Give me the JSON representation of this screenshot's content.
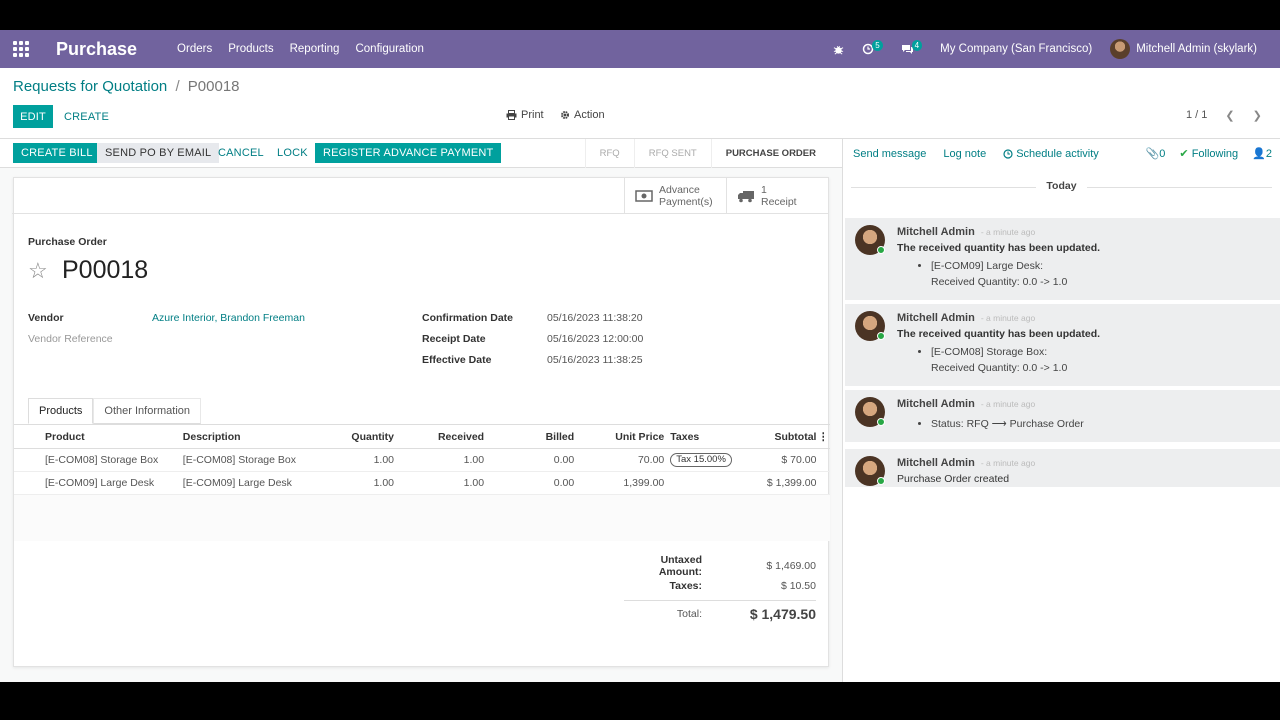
{
  "navbar": {
    "app_name": "Purchase",
    "menu": [
      "Orders",
      "Products",
      "Reporting",
      "Configuration"
    ],
    "activity_badge": "5",
    "messages_badge": "4",
    "company": "My Company (San Francisco)",
    "user": "Mitchell Admin (skylark)"
  },
  "breadcrumb": {
    "parent": "Requests for Quotation",
    "separator": "/",
    "current": "P00018"
  },
  "control": {
    "edit": "EDIT",
    "create": "CREATE",
    "print": "Print",
    "action": "Action",
    "pager": "1 / 1"
  },
  "statusbar": {
    "buttons": [
      "CREATE BILL",
      "SEND PO BY EMAIL",
      "CANCEL",
      "LOCK",
      "REGISTER ADVANCE PAYMENT"
    ],
    "stages": [
      "RFQ",
      "RFQ SENT",
      "PURCHASE ORDER"
    ],
    "active_stage": "PURCHASE ORDER"
  },
  "smart_buttons": {
    "advance": {
      "line1": "Advance",
      "line2": "Payment(s)"
    },
    "receipt": {
      "line1": "1",
      "line2": "Receipt"
    }
  },
  "form": {
    "heading": "Purchase Order",
    "name": "P00018",
    "vendor_label": "Vendor",
    "vendor_value": "Azure Interior, Brandon Freeman",
    "vendor_ref_label": "Vendor Reference",
    "confirmation_label": "Confirmation Date",
    "confirmation_value": "05/16/2023 11:38:20",
    "receipt_label": "Receipt Date",
    "receipt_value": "05/16/2023 12:00:00",
    "effective_label": "Effective Date",
    "effective_value": "05/16/2023 11:38:25"
  },
  "tabs": [
    "Products",
    "Other Information"
  ],
  "lines": {
    "headers": [
      "Product",
      "Description",
      "Quantity",
      "Received",
      "Billed",
      "Unit Price",
      "Taxes",
      "Subtotal"
    ],
    "rows": [
      {
        "product": "[E-COM08] Storage Box",
        "description": "[E-COM08] Storage Box",
        "quantity": "1.00",
        "received": "1.00",
        "billed": "0.00",
        "unit_price": "70.00",
        "taxes": "Tax 15.00%",
        "subtotal": "$ 70.00"
      },
      {
        "product": "[E-COM09] Large Desk",
        "description": "[E-COM09] Large Desk",
        "quantity": "1.00",
        "received": "1.00",
        "billed": "0.00",
        "unit_price": "1,399.00",
        "taxes": "",
        "subtotal": "$ 1,399.00"
      }
    ]
  },
  "totals": {
    "untaxed_label": "Untaxed Amount:",
    "untaxed_value": "$ 1,469.00",
    "taxes_label": "Taxes:",
    "taxes_value": "$ 10.50",
    "total_label": "Total:",
    "total_value": "$ 1,479.50"
  },
  "chatter": {
    "send_message": "Send message",
    "log_note": "Log note",
    "schedule_activity": "Schedule activity",
    "attachments": "0",
    "following": "Following",
    "followers": "2",
    "today": "Today",
    "messages": [
      {
        "author": "Mitchell Admin",
        "ago": "- a minute ago",
        "title": "The received quantity has been updated.",
        "item": "[E-COM09] Large Desk:",
        "detail": "Received Quantity: 0.0 -> 1.0"
      },
      {
        "author": "Mitchell Admin",
        "ago": "- a minute ago",
        "title": "The received quantity has been updated.",
        "item": "[E-COM08] Storage Box:",
        "detail": "Received Quantity: 0.0 -> 1.0"
      },
      {
        "author": "Mitchell Admin",
        "ago": "- a minute ago",
        "status": "Status: RFQ ⟶ Purchase Order"
      },
      {
        "author": "Mitchell Admin",
        "ago": "- a minute ago",
        "text": "Purchase Order created"
      }
    ]
  }
}
